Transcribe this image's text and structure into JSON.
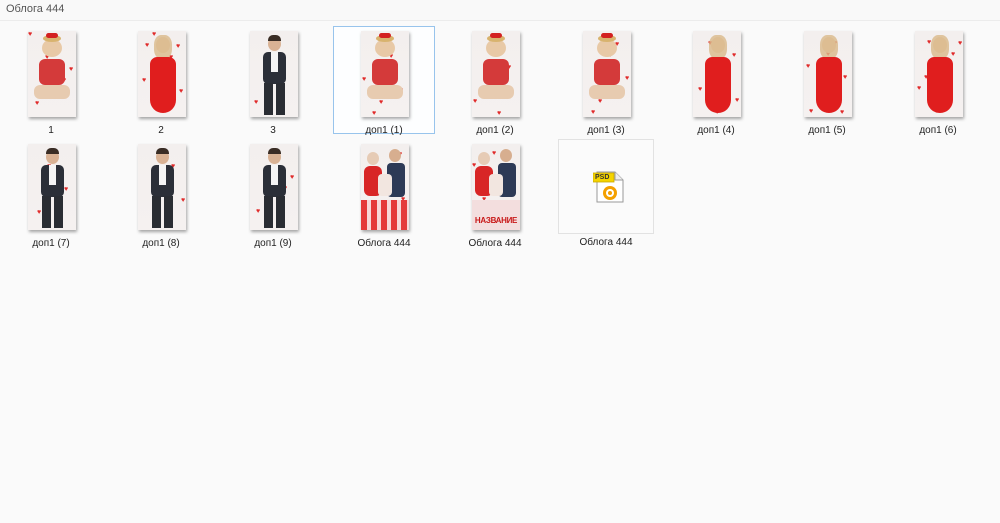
{
  "window": {
    "title": "Облога 444"
  },
  "files": [
    {
      "name": "1",
      "kind": "child-portrait"
    },
    {
      "name": "2",
      "kind": "woman-red-dress"
    },
    {
      "name": "3",
      "kind": "man-suit"
    },
    {
      "name": "доп1 (1)",
      "kind": "child-portrait",
      "selected": true
    },
    {
      "name": "доп1 (2)",
      "kind": "child-portrait"
    },
    {
      "name": "доп1 (3)",
      "kind": "child-portrait"
    },
    {
      "name": "доп1 (4)",
      "kind": "woman-red-dress"
    },
    {
      "name": "доп1 (5)",
      "kind": "woman-red-dress"
    },
    {
      "name": "доп1 (6)",
      "kind": "woman-red-dress"
    },
    {
      "name": "доп1 (7)",
      "kind": "man-suit"
    },
    {
      "name": "доп1 (8)",
      "kind": "man-suit"
    },
    {
      "name": "доп1 (9)",
      "kind": "man-suit"
    },
    {
      "name": "Облога  444",
      "kind": "couple-cover"
    },
    {
      "name": "Облога 444",
      "kind": "couple-cover-title",
      "cover_text": "НАЗВАНИЕ"
    },
    {
      "name": "Облога 444",
      "kind": "psd-file",
      "badge": "PSD"
    }
  ],
  "colors": {
    "accent_red": "#e02a2a",
    "selection_border": "#98c4ec",
    "psd_yellow": "#f5d400"
  }
}
